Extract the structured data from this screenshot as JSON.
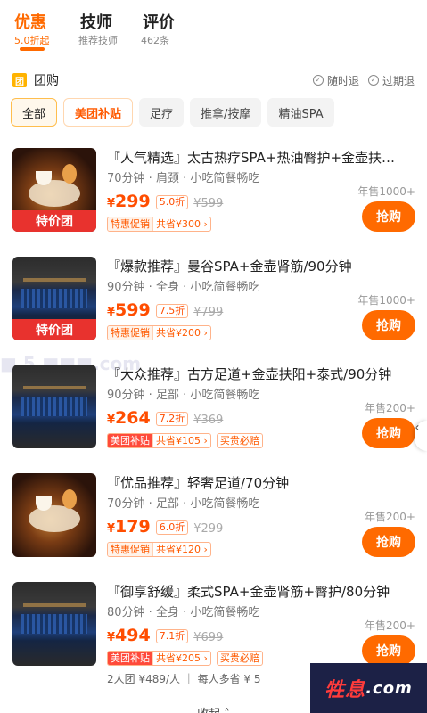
{
  "tabs": [
    {
      "title": "优惠",
      "sub": "5.0折起",
      "active": true
    },
    {
      "title": "技师",
      "sub": "推荐技师"
    },
    {
      "title": "评价",
      "sub": "462条"
    }
  ],
  "section": {
    "badge": "团",
    "title": "团购",
    "refund_anytime": "随时退",
    "refund_expired": "过期退"
  },
  "chips": [
    "全部",
    "美团补贴",
    "足疗",
    "推拿/按摩",
    "精油SPA"
  ],
  "deals": [
    {
      "title": "『人气精选』太古热疗SPA+热油臀护+金壶扶…",
      "meta": "70分钟 · 肩颈 · 小吃简餐畅吃",
      "yen": "¥",
      "price": "299",
      "discount": "5.0折",
      "original": "¥599",
      "tag_left": "特惠促销",
      "tag_right": "共省¥300 ›",
      "sold": "年售1000+",
      "buy": "抢购",
      "promo": "特价团"
    },
    {
      "title": "『爆款推荐』曼谷SPA+金壶肾筋/90分钟",
      "meta": "90分钟 · 全身 · 小吃简餐畅吃",
      "yen": "¥",
      "price": "599",
      "discount": "7.5折",
      "original": "¥799",
      "tag_left": "特惠促销",
      "tag_right": "共省¥200 ›",
      "sold": "年售1000+",
      "buy": "抢购",
      "promo": "特价团"
    },
    {
      "title": "『大众推荐』古方足道+金壶扶阳+泰式/90分钟",
      "meta": "90分钟 · 足部 · 小吃简餐畅吃",
      "yen": "¥",
      "price": "264",
      "discount": "7.2折",
      "original": "¥369",
      "tag_left": "美团补贴",
      "tag_right": "共省¥105 ›",
      "extra_tag": "买贵必赔",
      "sold": "年售200+",
      "buy": "抢购"
    },
    {
      "title": "『优品推荐』轻奢足道/70分钟",
      "meta": "70分钟 · 足部 · 小吃简餐畅吃",
      "yen": "¥",
      "price": "179",
      "discount": "6.0折",
      "original": "¥299",
      "tag_left": "特惠促销",
      "tag_right": "共省¥120 ›",
      "sold": "年售200+",
      "buy": "抢购"
    },
    {
      "title": "『御享舒缓』柔式SPA+金壶肾筋+臀护/80分钟",
      "meta": "80分钟 · 全身 · 小吃简餐畅吃",
      "yen": "¥",
      "price": "494",
      "discount": "7.1折",
      "original": "¥699",
      "tag_left": "美团补贴",
      "tag_right": "共省¥205 ›",
      "extra_tag": "买贵必赔",
      "sold": "年售200+",
      "buy": "抢购",
      "group_line": "2人团 ¥489/人 ｜ 每人多省 ¥ 5"
    }
  ],
  "collapse": "收起 ˄",
  "watermark": {
    "text": "牲息",
    "suffix": ".com"
  },
  "overlay": {
    "ghost": "■ 5.■■■.com",
    "edge": "‹"
  },
  "colors": {
    "accent": "#ff6a00",
    "price": "#ff4d00",
    "promo": "#e8322e"
  }
}
